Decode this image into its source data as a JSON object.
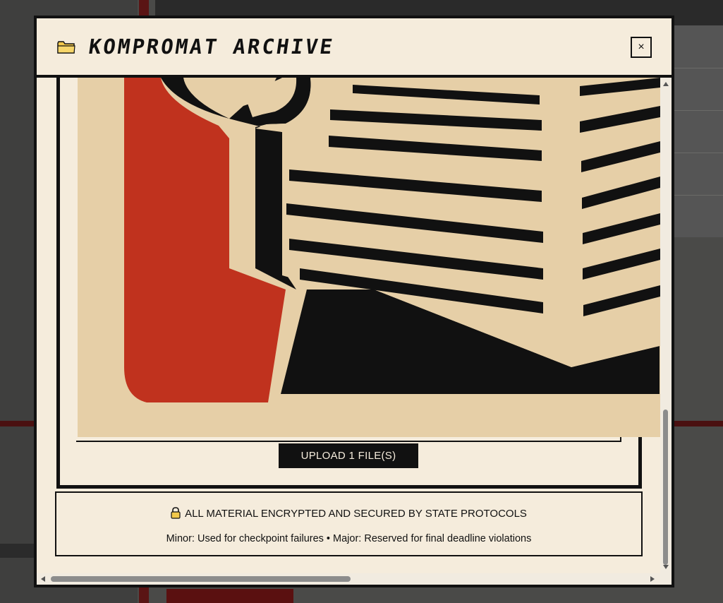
{
  "modal": {
    "title": "KOMPROMAT ARCHIVE",
    "close_label": "×",
    "upload_button_label": "UPLOAD 1 FILE(S)",
    "security_notice": "ALL MATERIAL ENCRYPTED AND SECURED BY STATE PROTOCOLS",
    "severity_legend": "Minor: Used for checkpoint failures • Major: Reserved for final deadline violations"
  },
  "icons": {
    "title_icon": "folder-icon",
    "notice_icon": "lock-icon",
    "close_icon": "close-icon"
  },
  "colors": {
    "modal_background": "#f5ecdc",
    "border": "#111111",
    "poster_red": "#c0321e",
    "poster_cream": "#e6cfa7",
    "button_background": "#111111"
  }
}
